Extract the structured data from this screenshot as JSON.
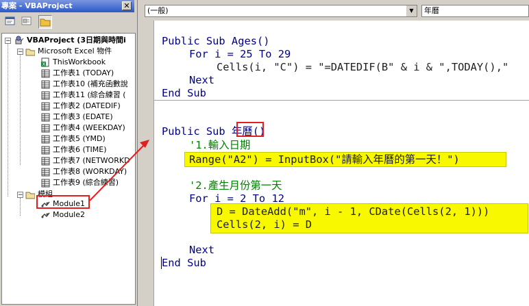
{
  "project_pane": {
    "title": "專案 - VBAProject",
    "close_glyph": "✕",
    "tree": {
      "root": "VBAProject (3日期與時間i",
      "excel_folder": "Microsoft Excel 物件",
      "this_workbook": "ThisWorkbook",
      "sheets": [
        "工作表1 (TODAY)",
        "工作表10 (補充函數說",
        "工作表11 (綜合練習 (",
        "工作表2 (DATEDIF)",
        "工作表3 (EDATE)",
        "工作表4 (WEEKDAY)",
        "工作表5 (YMD)",
        "工作表6 (TIME)",
        "工作表7 (NETWORKD",
        "工作表8 (WORKDAY)",
        "工作表9 (綜合練習)"
      ],
      "modules_folder": "模組",
      "modules": [
        "Module1",
        "Module2"
      ]
    }
  },
  "code_window": {
    "object_combo": "(一般)",
    "procedure_combo": "年曆",
    "code": {
      "ages_sub": "Public Sub Ages()",
      "ages_for": "For i = 25 To 29",
      "ages_cells": "Cells(i, \"C\") = \"=DATEDIF(B\" & i & \",TODAY(),\"",
      "ages_next": "Next",
      "ages_end": "End Sub",
      "cal_sub_prefix": "Public Sub ",
      "cal_sub_name": "年曆",
      "cal_sub_suffix": "()",
      "comment1": "'1.輸入日期",
      "range_line": "Range(\"A2\") = InputBox(\"請輸入年曆的第一天！\")",
      "comment2": "'2.產生月份第一天",
      "cal_for": "For i = 2 To 12",
      "dateadd_line": "D = DateAdd(\"m\", i - 1, CDate(Cells(2, 1)))",
      "cells_line": "Cells(2, i) = D",
      "cal_next": "Next",
      "cal_end": "End Sub"
    }
  },
  "colors": {
    "highlight": "#f8f800",
    "annotation_red": "#e02020",
    "comment": "#008000",
    "keyword": "#00008b"
  }
}
